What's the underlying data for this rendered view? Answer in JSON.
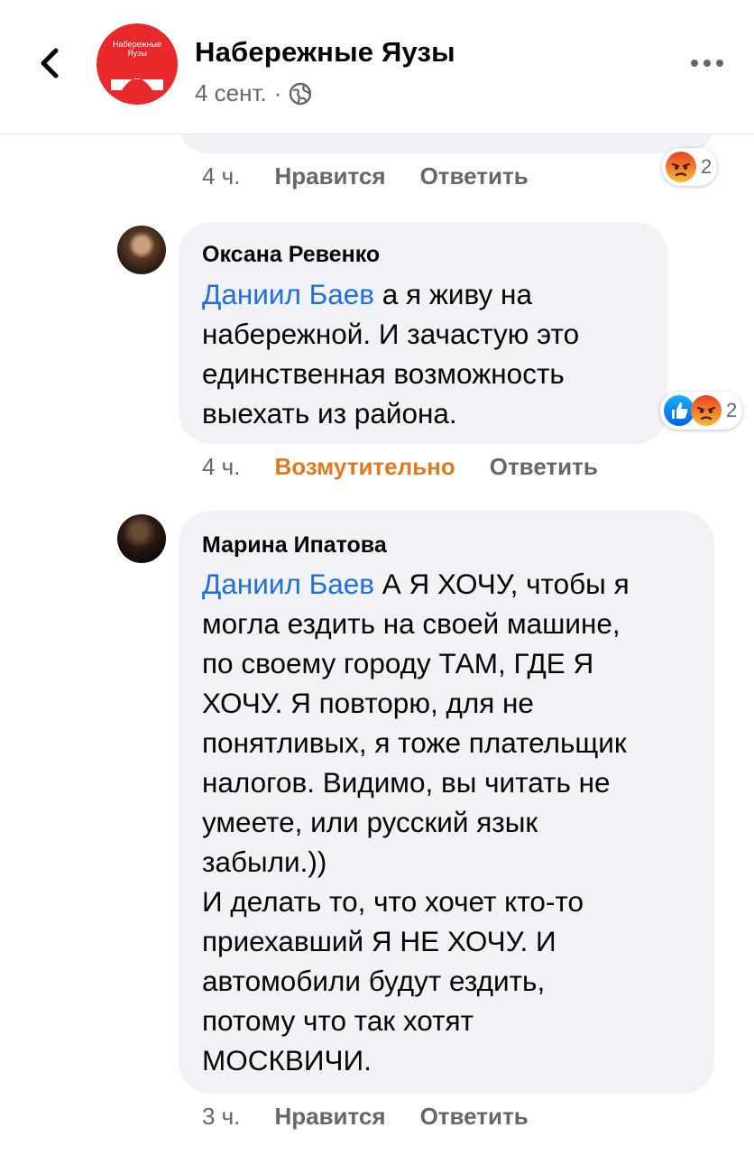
{
  "header": {
    "back_icon": "chevron-left-icon",
    "page_logo_text": "Набережные\nЯузы",
    "page_name": "Набережные Яузы",
    "post_date": "4 сент.",
    "separator": "·",
    "privacy_icon": "globe-icon",
    "more_icon": "more-horizontal-icon"
  },
  "previous_comment": {
    "time": "4 ч.",
    "like_label": "Нравится",
    "reply_label": "Ответить",
    "reactions": {
      "icons": [
        "angry-icon"
      ],
      "count": "2"
    }
  },
  "comments": [
    {
      "author": "Оксана Ревенко",
      "mention": "Даниил Баев",
      "text_lines": [
        " а я живу на",
        "набережной. И зачастую это",
        "единственная возможность",
        "выехать из района."
      ],
      "time": "4 ч.",
      "reaction_label": "Возмутительно",
      "reply_label": "Ответить",
      "reactions": {
        "icons": [
          "like-icon",
          "angry-icon"
        ],
        "count": "2"
      }
    },
    {
      "author": "Марина Ипатова",
      "mention": "Даниил Баев",
      "text_lines": [
        " А Я ХОЧУ, чтобы я",
        "могла ездить на своей машине,",
        "по своему городу ТАМ, ГДЕ Я",
        "ХОЧУ. Я повторю, для не",
        "понятливых, я тоже плательщик",
        "налогов. Видимо, вы читать не",
        "умеете, или русский язык",
        "забыли.))",
        "И делать то, что хочет кто-то",
        "приехавший Я НЕ ХОЧУ. И",
        "автомобили будут ездить,",
        "потому что так хотят",
        "МОСКВИЧИ."
      ],
      "time": "3 ч.",
      "like_label": "Нравится",
      "reply_label": "Ответить"
    }
  ],
  "colors": {
    "accent_blue": "#216fdb",
    "angry_orange": "#e07a1f",
    "bubble_bg": "#f0f2f5",
    "meta_gray": "#65676b",
    "logo_red": "#e8282b"
  }
}
